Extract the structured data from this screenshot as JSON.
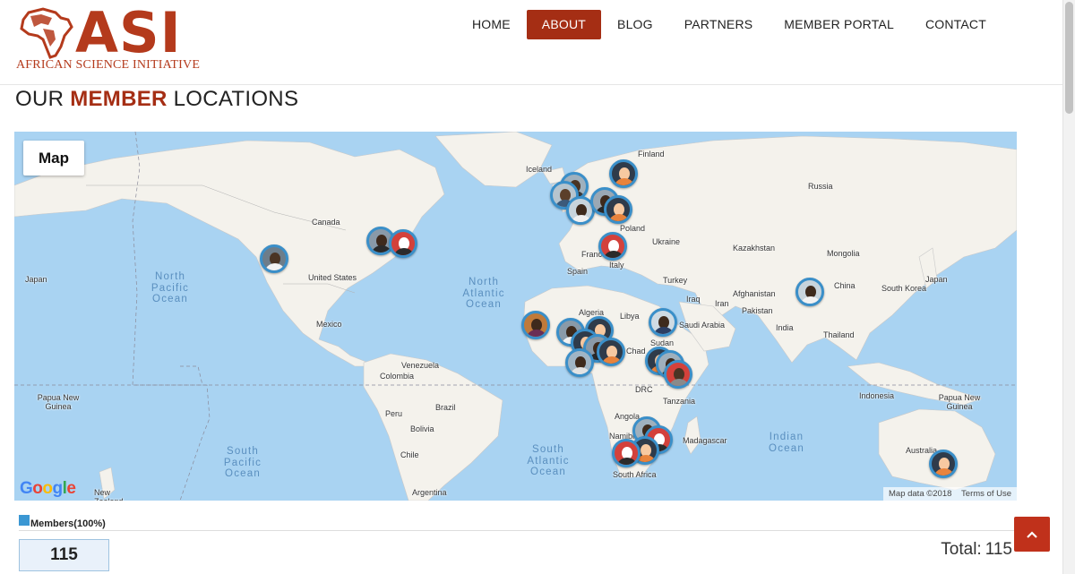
{
  "brand": {
    "acronym": "ASI",
    "full_name": "African Science Initiative",
    "color": "#b43a1c"
  },
  "nav": {
    "items": [
      {
        "label": "HOME",
        "active": false
      },
      {
        "label": "ABOUT",
        "active": true
      },
      {
        "label": "BLOG",
        "active": false
      },
      {
        "label": "PARTNERS",
        "active": false
      },
      {
        "label": "MEMBER PORTAL",
        "active": false
      },
      {
        "label": "CONTACT",
        "active": false
      }
    ],
    "active_color": "#a52e14"
  },
  "section": {
    "title_prefix": "OUR",
    "title_accent": "MEMBER",
    "title_suffix": "LOCATIONS"
  },
  "map": {
    "type_button": "Map",
    "attribution": "Map data ©2018",
    "terms": "Terms of Use",
    "provider": "Google",
    "countries": [
      "Iceland",
      "Finland",
      "Russia",
      "Canada",
      "Poland",
      "Ukraine",
      "Kazakhstan",
      "Mongolia",
      "France",
      "Italy",
      "Spain",
      "Turkey",
      "Japan",
      "United States",
      "Iraq",
      "Afghanistan",
      "Iran",
      "Pakistan",
      "China",
      "South Korea",
      "Mexico",
      "Algeria",
      "Libya",
      "Saudi Arabia",
      "India",
      "Thailand",
      "Chad",
      "Sudan",
      "Venezuela",
      "Colombia",
      "DRC",
      "Tanzania",
      "Indonesia",
      "Papua New Guinea",
      "Peru",
      "Brazil",
      "Angola",
      "Bolivia",
      "Namibia",
      "Madagascar",
      "Chile",
      "South Africa",
      "Australia",
      "Argentina",
      "New Zealand"
    ],
    "oceans": [
      "North Pacific Ocean",
      "North Atlantic Ocean",
      "South Pacific Ocean",
      "South Atlantic Ocean",
      "Indian Ocean"
    ],
    "ocean_color": "#a9d3f2",
    "land_color": "#f4f2ec",
    "marker_border": "#3a8fc9"
  },
  "legend": {
    "label": "Members(100%)",
    "color": "#3b97d3",
    "count": "115"
  },
  "total": {
    "label": "Total:",
    "value": "115"
  },
  "back_to_top_icon": "chevron-up-icon"
}
